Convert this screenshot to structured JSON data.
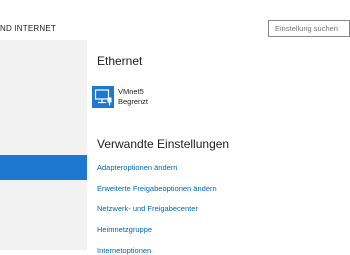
{
  "header": {
    "title": "ND INTERNET",
    "search_placeholder": "Einstellung suchen"
  },
  "ethernet": {
    "title": "Ethernet",
    "adapter": {
      "name": "VMnet5",
      "status": "Begrenzt",
      "icon": "network-adapter-icon"
    }
  },
  "related": {
    "title": "Verwandte Einstellungen",
    "links": [
      "Adapteroptionen ändern",
      "Erweiterte Freigabeoptionen ändern",
      "Netzwerk- und Freigabecenter",
      "Heimnetzgruppe",
      "Internetoptionen"
    ]
  },
  "colors": {
    "accent": "#1e78d0",
    "link": "#0067c0",
    "sidebar_bg": "#f2f2f2"
  }
}
